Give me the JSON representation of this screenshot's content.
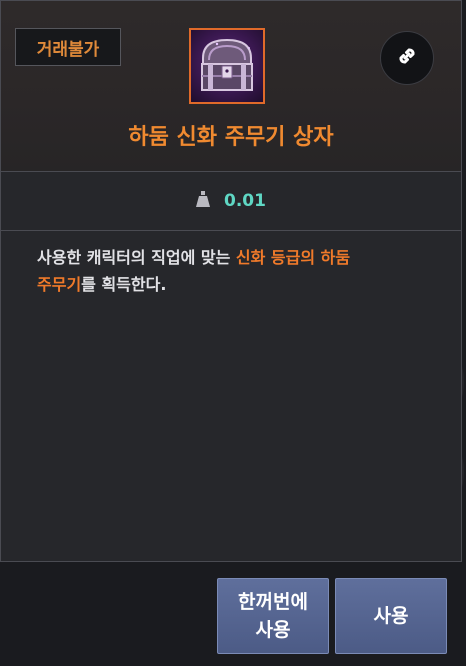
{
  "tooltip": {
    "trade_badge": "거래불가",
    "item_icon": "treasure-chest-icon",
    "title": "하둠 신화 주무기 상자",
    "weight": "0.01",
    "description": {
      "part1": "사용한 캐릭터의 직업에 맞는 ",
      "highlight1": "신화 등급의 하둠",
      "line_break_highlight": "주무기",
      "part2": "를 획득한다."
    },
    "colors": {
      "title": "#f08a30",
      "highlight": "#f07a2a",
      "weight": "#5fd7c4"
    }
  },
  "buttons": {
    "bulk_use_line1": "한꺼번에",
    "bulk_use_line2": "사용",
    "use": "사용"
  }
}
